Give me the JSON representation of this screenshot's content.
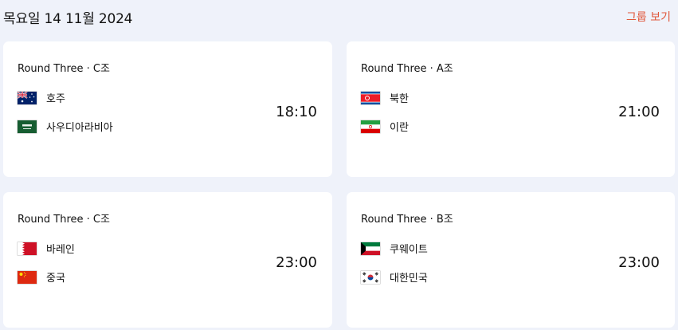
{
  "header": {
    "date": "목요일 14 11월 2024",
    "group_link": "그룹 보기"
  },
  "matches": [
    {
      "round": "Round Three · C조",
      "home": {
        "name": "호주",
        "flag": "australia-flag"
      },
      "away": {
        "name": "사우디아라비아",
        "flag": "saudi-arabia-flag"
      },
      "time": "18:10"
    },
    {
      "round": "Round Three · A조",
      "home": {
        "name": "북한",
        "flag": "north-korea-flag"
      },
      "away": {
        "name": "이란",
        "flag": "iran-flag"
      },
      "time": "21:00"
    },
    {
      "round": "Round Three · C조",
      "home": {
        "name": "바레인",
        "flag": "bahrain-flag"
      },
      "away": {
        "name": "중국",
        "flag": "china-flag"
      },
      "time": "23:00"
    },
    {
      "round": "Round Three · B조",
      "home": {
        "name": "쿠웨이트",
        "flag": "kuwait-flag"
      },
      "away": {
        "name": "대한민국",
        "flag": "south-korea-flag"
      },
      "time": "23:00"
    }
  ],
  "colors": {
    "background": "#eff2fa",
    "card": "#ffffff",
    "accent": "#e0573a"
  }
}
